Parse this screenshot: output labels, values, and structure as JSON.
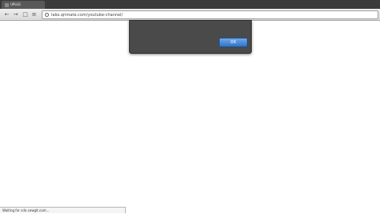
{
  "browser": {
    "tabs": [
      {
        "label": "UPLUS",
        "active": true
      }
    ],
    "address_bar": {
      "url": "labs.qrimate.com/youtube-channel/"
    }
  },
  "dialog": {
    "ok_label": "OK"
  },
  "status_bar": {
    "text": "Waiting for cdn.cewgit.com..."
  },
  "colors": {
    "tabbar_bg": "#3a3a3a",
    "dialog_bg": "#4a4a4a",
    "ok_button": "#3472c4"
  }
}
